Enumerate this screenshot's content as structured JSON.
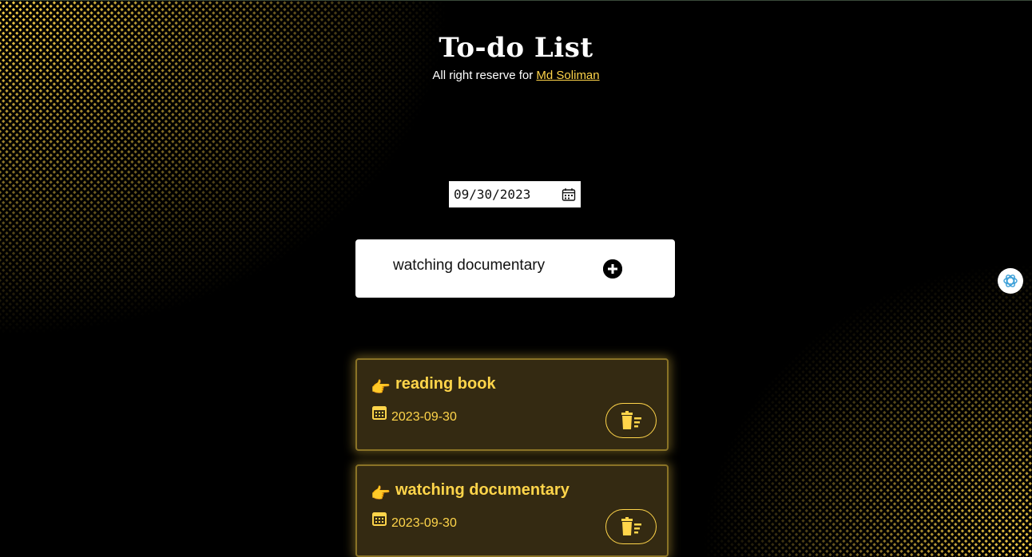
{
  "header": {
    "title": "To-do List",
    "subtitle_prefix": "All right reserve for ",
    "author_link": "Md Soliman"
  },
  "date_input": {
    "value": "09/30/2023",
    "icon": "calendar-icon"
  },
  "task_input": {
    "value": "watching documentary",
    "add_icon": "plus-circle-icon"
  },
  "tasks": [
    {
      "name": "reading book",
      "date": "2023-09-30",
      "icon": "pointing-hand-icon"
    },
    {
      "name": "watching documentary",
      "date": "2023-09-30",
      "icon": "pointing-hand-icon"
    }
  ],
  "colors": {
    "accent": "#ffd54a",
    "background": "#000000",
    "card": "#342a12"
  }
}
